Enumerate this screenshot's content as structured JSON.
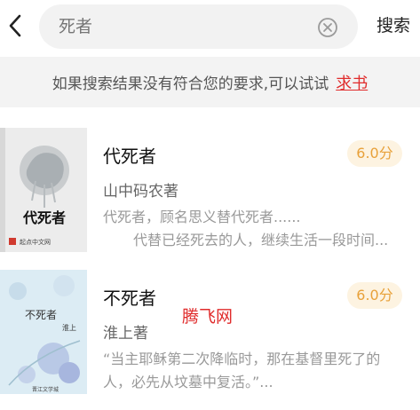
{
  "search": {
    "placeholder": "死者",
    "button_label": "搜索"
  },
  "notice": {
    "text": "如果搜索结果没有符合您的要求,可以试试",
    "link": "求书"
  },
  "books": [
    {
      "title": "代死者",
      "author": "山中码农著",
      "score": "6.0分",
      "desc_line1": "代死者，顾名思义替代死者......",
      "desc_line2": "代替已经死去的人，继续生活一段时间...",
      "cover": {
        "title": "代死者",
        "publisher": "起点中文网"
      }
    },
    {
      "title": "不死者",
      "author": "淮上著",
      "score": "6.0分",
      "desc_line1": "“当主耶稣第二次降临时，那在基督里死了的",
      "desc_line2": "人，必先从坟墓中复活。”...",
      "cover": {
        "title": "不死者",
        "author": "淮上",
        "publisher": "晋江文学城"
      }
    }
  ],
  "watermark": "腾飞网",
  "colors": {
    "accent_red": "#e02b2b",
    "score_text": "#e8a13a",
    "score_bg": "#fdf3e1",
    "notice_bg": "#f3f3f3"
  }
}
